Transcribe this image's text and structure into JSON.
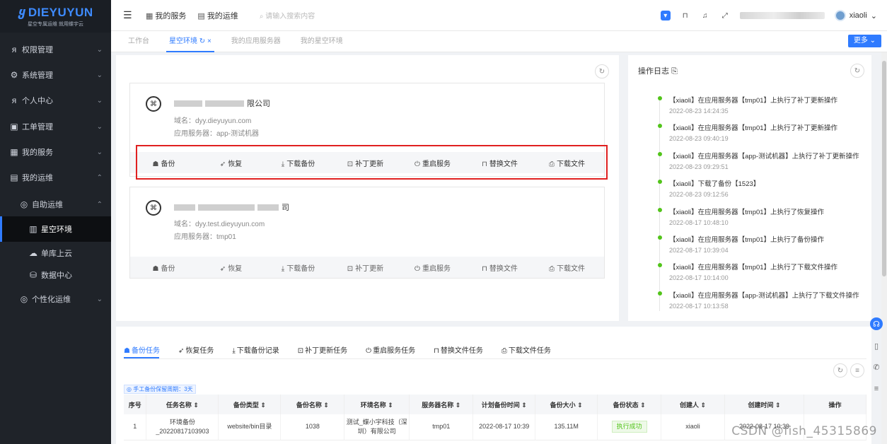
{
  "logo": {
    "brand": "DIEYUYUN",
    "tagline": "星空专属运维 就用蝶宇云"
  },
  "sidebar": {
    "items": [
      {
        "label": "权限管理"
      },
      {
        "label": "系统管理"
      },
      {
        "label": "个人中心"
      },
      {
        "label": "工单管理"
      },
      {
        "label": "我的服务"
      },
      {
        "label": "我的运维"
      },
      {
        "label": "自助运维"
      },
      {
        "label": "星空环境"
      },
      {
        "label": "单库上云"
      },
      {
        "label": "数据中心"
      },
      {
        "label": "个性化运维"
      }
    ]
  },
  "header": {
    "nav": [
      "我的服务",
      "我的运维"
    ],
    "search_placeholder": "请输入搜索内容",
    "user": "xiaoli"
  },
  "tabs": {
    "items": [
      "工作台",
      "星空环境",
      "我的应用服务器",
      "我的星空环境"
    ],
    "more": "更多"
  },
  "env_cards": [
    {
      "org_suffix": "限公司",
      "domain": "域名：dyy.dieyuyun.com",
      "server": "应用服务器：app-测试机器"
    },
    {
      "org_suffix": "司",
      "domain": "域名：dyy.test.dieyuyun.com",
      "server": "应用服务器：tmp01"
    }
  ],
  "actions": [
    "备份",
    "恢复",
    "下载备份",
    "补丁更新",
    "重启服务",
    "替换文件",
    "下载文件"
  ],
  "log": {
    "title": "操作日志",
    "items": [
      {
        "text": "【xiaoli】在应用服务器【tmp01】上执行了补丁更新操作",
        "time": "2022-08-23 14:24:35"
      },
      {
        "text": "【xiaoli】在应用服务器【tmp01】上执行了补丁更新操作",
        "time": "2022-08-23 09:40:19"
      },
      {
        "text": "【xiaoli】在应用服务器【app-测试机器】上执行了补丁更新操作",
        "time": "2022-08-23 09:29:51"
      },
      {
        "text": "【xiaoli】下载了备份【1523】",
        "time": "2022-08-23 09:12:56"
      },
      {
        "text": "【xiaoli】在应用服务器【tmp01】上执行了恢复操作",
        "time": "2022-08-17 10:48:10"
      },
      {
        "text": "【xiaoli】在应用服务器【tmp01】上执行了备份操作",
        "time": "2022-08-17 10:39:04"
      },
      {
        "text": "【xiaoli】在应用服务器【tmp01】上执行了下载文件操作",
        "time": "2022-08-17 10:14:00"
      },
      {
        "text": "【xiaoli】在应用服务器【app-测试机器】上执行了下载文件操作",
        "time": "2022-08-17 10:13:58"
      }
    ]
  },
  "bottom_tabs": [
    "备份任务",
    "恢复任务",
    "下载备份记录",
    "补丁更新任务",
    "重启服务任务",
    "替换文件任务",
    "下载文件任务"
  ],
  "retention_note": "◎ 手工备份保留周期：3天",
  "table": {
    "headers": [
      "序号",
      "任务名称 ⇕",
      "备份类型 ⇕",
      "备份名称 ⇕",
      "环境名称 ⇕",
      "服务器名称 ⇕",
      "计划备份时间 ⇕",
      "备份大小 ⇕",
      "备份状态 ⇕",
      "创建人 ⇕",
      "创建时间 ⇕",
      "操作"
    ],
    "rows": [
      [
        "1",
        "环境备份_20220817103903",
        "website/bin目录",
        "1038",
        "测试_蝶小宇科技（深圳）有限公司",
        "tmp01",
        "2022-08-17 10:39",
        "135.11M",
        "执行成功",
        "xiaoli",
        "2022-08-17 10:39",
        ""
      ]
    ]
  },
  "watermark": "CSDN @fish_45315869",
  "colors": {
    "accent": "#2f7bff",
    "sidebar": "#1f2329",
    "success": "#52c41a",
    "highlight": "#e02020"
  }
}
